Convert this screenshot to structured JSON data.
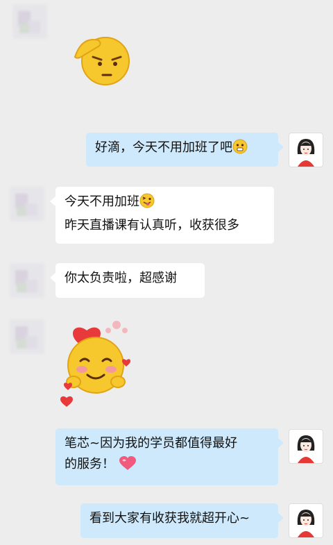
{
  "messages": {
    "m1_text": "好滴，今天不用加班了吧",
    "m2_line1": "今天不用加班",
    "m2_line2": "昨天直播课有认真听，收获很多",
    "m3_text": "你太负责啦，超感谢",
    "m4_line1": "笔芯~因为我的学员都值得最好",
    "m4_line2": "的服务！",
    "m5_text": "看到大家有收获我就超开心~"
  },
  "icons": {
    "salute_sticker": "salute-emoji-sticker",
    "heart_sticker": "finger-heart-emoji-sticker",
    "hmm_emoji": "hmm-face-icon",
    "wink_emoji": "wink-tongue-icon",
    "heart_emoji": "heart-icon"
  },
  "colors": {
    "background": "#ededed",
    "bubble_self": "#cde9fb",
    "bubble_other": "#ffffff"
  }
}
